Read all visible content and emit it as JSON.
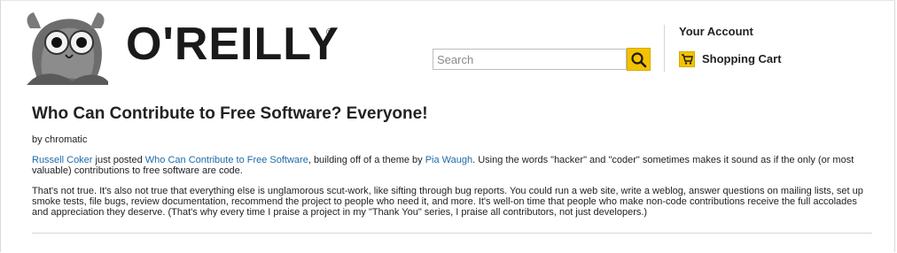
{
  "header": {
    "logo_text": "O'REILLY",
    "logo_registered": "®",
    "search": {
      "placeholder": "Search",
      "value": ""
    },
    "account_label": "Your Account",
    "cart_label": "Shopping Cart"
  },
  "article": {
    "title": "Who Can Contribute to Free Software? Everyone!",
    "byline": "by chromatic",
    "p1": {
      "link1": "Russell Coker",
      "text1": " just posted ",
      "link2": "Who Can Contribute to Free Software",
      "text2": ", building off of a theme by ",
      "link3": "Pia Waugh",
      "text3": ". Using the words \"hacker\" and \"coder\" sometimes makes it sound as if the only (or most valuable) contributions to free software are code."
    },
    "p2": "That's not true. It's also not true that everything else is unglamorous scut-work, like sifting through bug reports. You could run a web site, write a weblog, answer questions on mailing lists, set up smoke tests, file bugs, review documentation, recommend the project to people who need it, and more. It's well-on time that people who make non-code contributions receive the full accolades and appreciation they deserve. (That's why every time I praise a project in my \"Thank You\" series, I praise all contributors, not just developers.)"
  },
  "colors": {
    "accent_yellow": "#f3c300",
    "link_blue": "#1f6aa8",
    "logo_red_dot": "#d3002d"
  }
}
